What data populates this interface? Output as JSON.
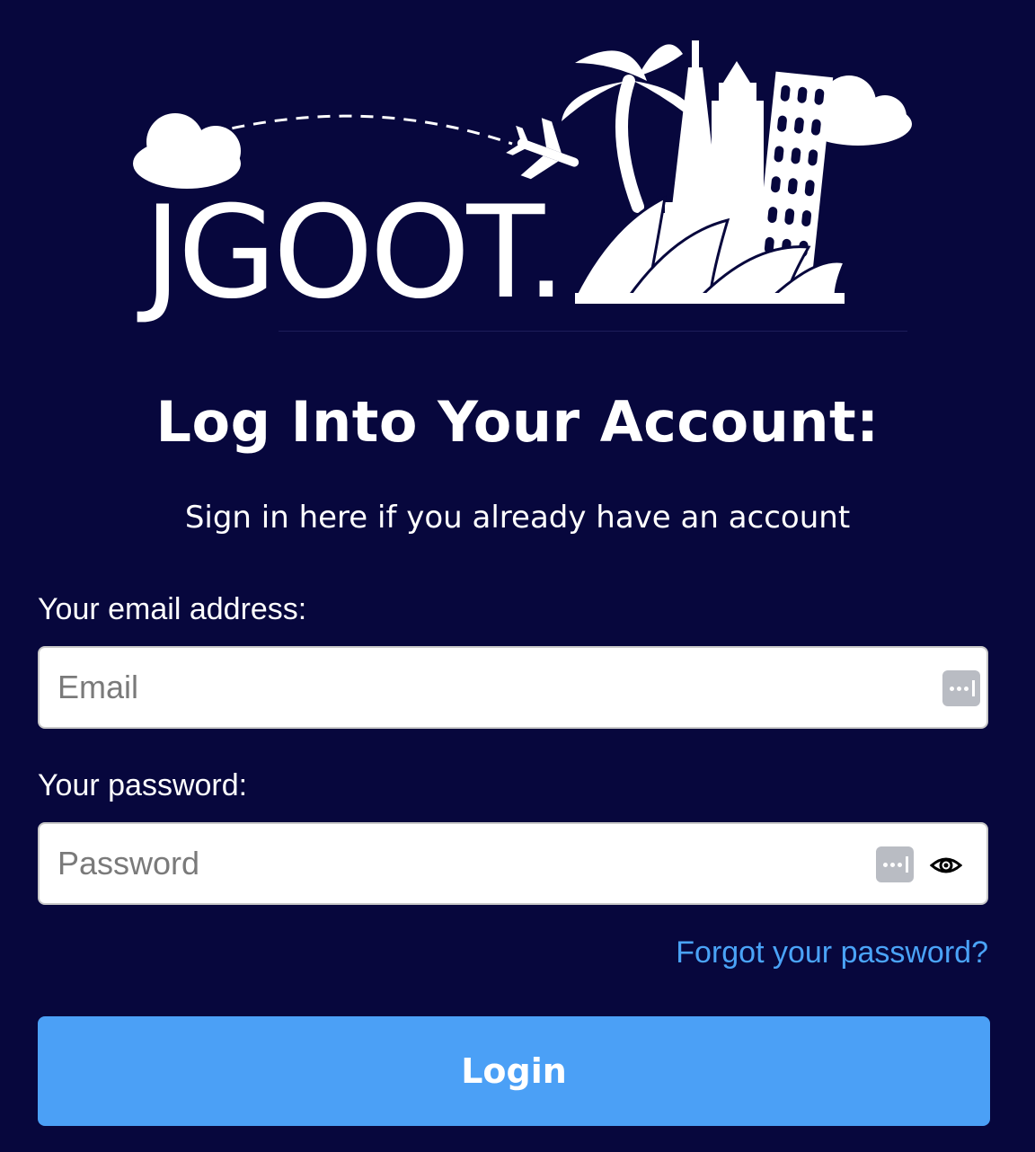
{
  "brand": {
    "logo_text": "JGOOT."
  },
  "login": {
    "title": "Log Into Your Account:",
    "subtitle": "Sign in here if you already have an account"
  },
  "form": {
    "email": {
      "label": "Your email address:",
      "placeholder": "Email",
      "value": ""
    },
    "password": {
      "label": "Your password:",
      "placeholder": "Password",
      "value": ""
    },
    "forgot_password_link": "Forgot your password?",
    "login_button": "Login"
  },
  "colors": {
    "background": "#07073d",
    "accent": "#4ba0f6",
    "link": "#4aa3f7",
    "text": "#ffffff"
  },
  "icons": {
    "email_field_icon": "autofill-key-icon",
    "password_field_icons": [
      "autofill-key-icon",
      "eye-icon"
    ]
  }
}
